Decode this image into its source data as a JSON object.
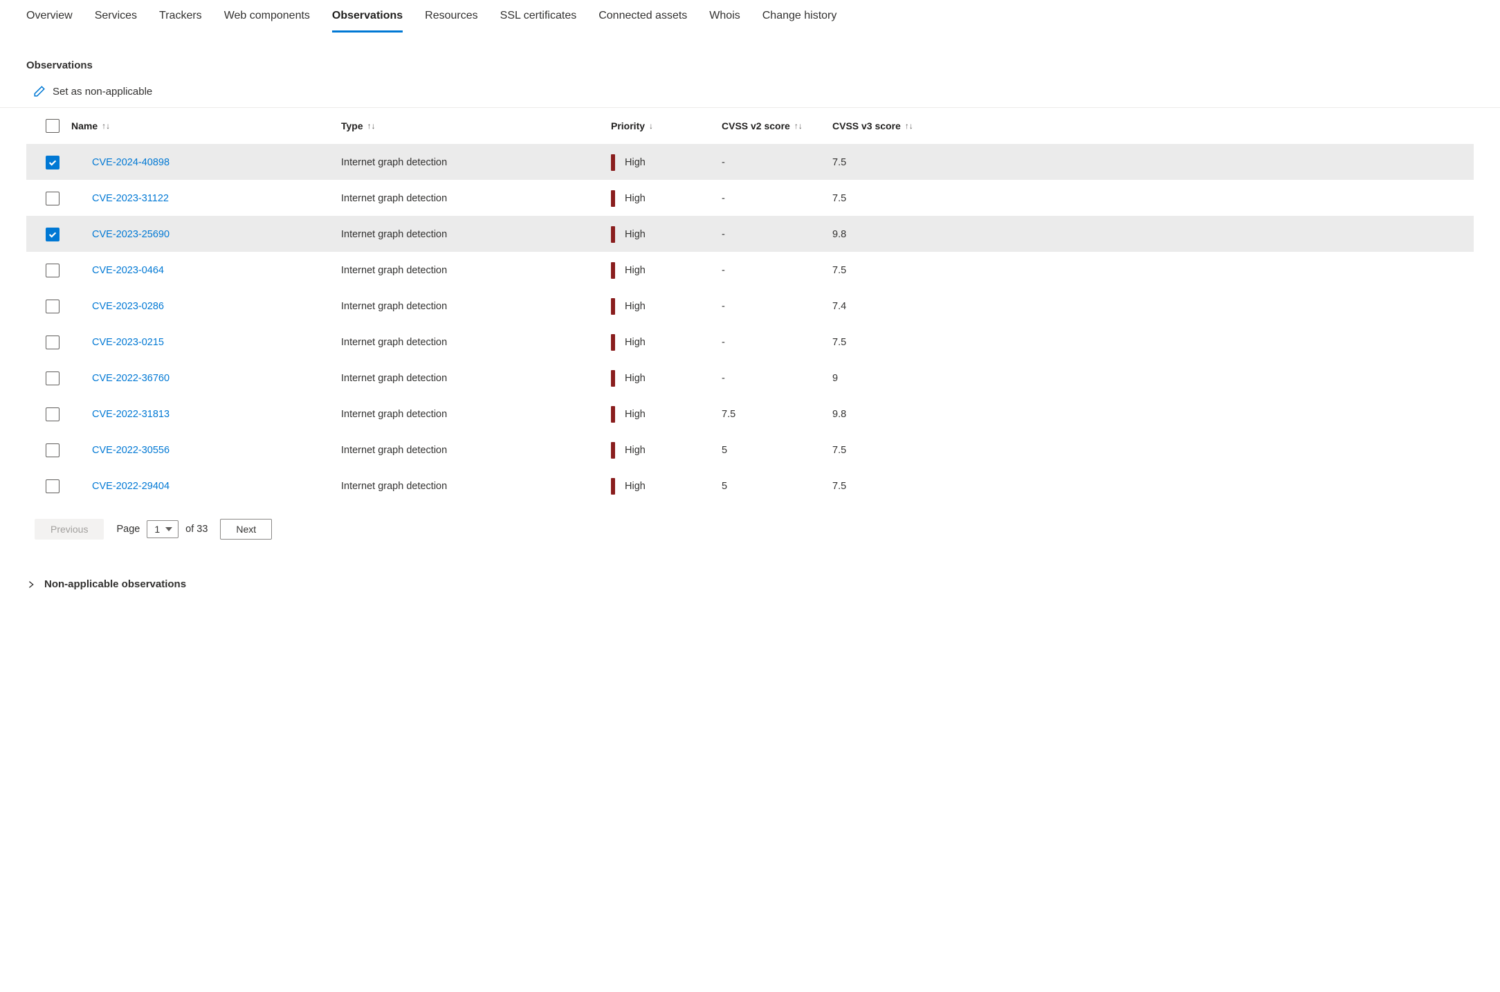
{
  "tabs": [
    {
      "label": "Overview",
      "active": false
    },
    {
      "label": "Services",
      "active": false
    },
    {
      "label": "Trackers",
      "active": false
    },
    {
      "label": "Web components",
      "active": false
    },
    {
      "label": "Observations",
      "active": true
    },
    {
      "label": "Resources",
      "active": false
    },
    {
      "label": "SSL certificates",
      "active": false
    },
    {
      "label": "Connected assets",
      "active": false
    },
    {
      "label": "Whois",
      "active": false
    },
    {
      "label": "Change history",
      "active": false
    }
  ],
  "section": {
    "heading": "Observations",
    "action_label": "Set as non-applicable"
  },
  "columns": {
    "name": "Name",
    "type": "Type",
    "priority": "Priority",
    "cvss2": "CVSS v2 score",
    "cvss3": "CVSS v3 score",
    "name_sort": "↑↓",
    "type_sort": "↑↓",
    "priority_sort": "↓",
    "cvss2_sort": "↑↓",
    "cvss3_sort": "↑↓"
  },
  "rows": [
    {
      "selected": true,
      "name": "CVE-2024-40898",
      "type": "Internet graph detection",
      "priority": "High",
      "cvss2": "-",
      "cvss3": "7.5"
    },
    {
      "selected": false,
      "name": "CVE-2023-31122",
      "type": "Internet graph detection",
      "priority": "High",
      "cvss2": "-",
      "cvss3": "7.5"
    },
    {
      "selected": true,
      "name": "CVE-2023-25690",
      "type": "Internet graph detection",
      "priority": "High",
      "cvss2": "-",
      "cvss3": "9.8"
    },
    {
      "selected": false,
      "name": "CVE-2023-0464",
      "type": "Internet graph detection",
      "priority": "High",
      "cvss2": "-",
      "cvss3": "7.5"
    },
    {
      "selected": false,
      "name": "CVE-2023-0286",
      "type": "Internet graph detection",
      "priority": "High",
      "cvss2": "-",
      "cvss3": "7.4"
    },
    {
      "selected": false,
      "name": "CVE-2023-0215",
      "type": "Internet graph detection",
      "priority": "High",
      "cvss2": "-",
      "cvss3": "7.5"
    },
    {
      "selected": false,
      "name": "CVE-2022-36760",
      "type": "Internet graph detection",
      "priority": "High",
      "cvss2": "-",
      "cvss3": "9"
    },
    {
      "selected": false,
      "name": "CVE-2022-31813",
      "type": "Internet graph detection",
      "priority": "High",
      "cvss2": "7.5",
      "cvss3": "9.8"
    },
    {
      "selected": false,
      "name": "CVE-2022-30556",
      "type": "Internet graph detection",
      "priority": "High",
      "cvss2": "5",
      "cvss3": "7.5"
    },
    {
      "selected": false,
      "name": "CVE-2022-29404",
      "type": "Internet graph detection",
      "priority": "High",
      "cvss2": "5",
      "cvss3": "7.5"
    }
  ],
  "pagination": {
    "previous": "Previous",
    "page_label": "Page",
    "current_page": "1",
    "of_label": "of 33",
    "next": "Next"
  },
  "expandable": {
    "label": "Non-applicable observations"
  }
}
